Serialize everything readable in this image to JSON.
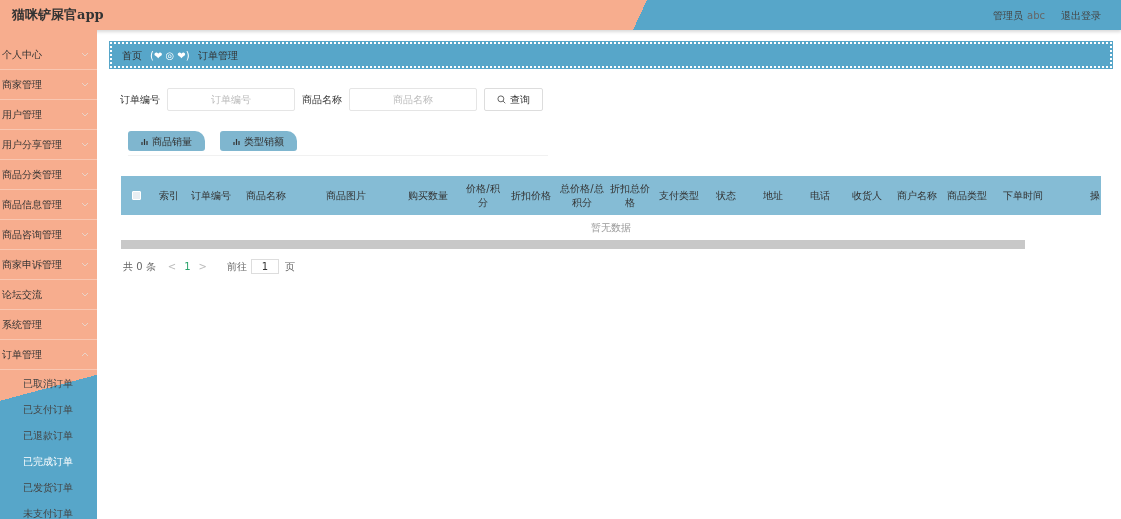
{
  "header": {
    "title": "猫咪铲屎官app",
    "role": "管理员",
    "user": "abc",
    "logout": "退出登录"
  },
  "sidebar": {
    "items": [
      {
        "label": "个人中心",
        "expanded": false
      },
      {
        "label": "商家管理",
        "expanded": false
      },
      {
        "label": "用户管理",
        "expanded": false
      },
      {
        "label": "用户分享管理",
        "expanded": false
      },
      {
        "label": "商品分类管理",
        "expanded": false
      },
      {
        "label": "商品信息管理",
        "expanded": false
      },
      {
        "label": "商品咨询管理",
        "expanded": false
      },
      {
        "label": "商家申诉管理",
        "expanded": false
      },
      {
        "label": "论坛交流",
        "expanded": false
      },
      {
        "label": "系统管理",
        "expanded": false
      },
      {
        "label": "订单管理",
        "expanded": true,
        "children": [
          {
            "label": "已取消订单",
            "selected": false
          },
          {
            "label": "已支付订单",
            "selected": false
          },
          {
            "label": "已退款订单",
            "selected": false
          },
          {
            "label": "已完成订单",
            "selected": true
          },
          {
            "label": "已发货订单",
            "selected": false
          },
          {
            "label": "未支付订单",
            "selected": false
          }
        ]
      }
    ]
  },
  "breadcrumb": {
    "home": "首页",
    "separator": "(❤ ◎ ❤)",
    "current": "订单管理"
  },
  "search": {
    "fields": [
      {
        "label": "订单编号",
        "placeholder": "订单编号"
      },
      {
        "label": "商品名称",
        "placeholder": "商品名称"
      }
    ],
    "button": "查询"
  },
  "chart_buttons": [
    "商品销量",
    "类型销额"
  ],
  "table": {
    "select_all_checked": false,
    "columns": [
      "索引",
      "订单编号",
      "商品名称",
      "商品图片",
      "购买数量",
      "价格/积分",
      "折扣价格",
      "总价格/总积分",
      "折扣总价格",
      "支付类型",
      "状态",
      "地址",
      "电话",
      "收货人",
      "商户名称",
      "商品类型",
      "下单时间",
      "操"
    ],
    "empty_text": "暂无数据"
  },
  "pagination": {
    "total": "共 0 条",
    "prev": "<",
    "pages": [
      {
        "label": "1",
        "selected": true
      }
    ],
    "next": ">",
    "goto": "前往",
    "page_input": "1",
    "page_unit": "页"
  }
}
